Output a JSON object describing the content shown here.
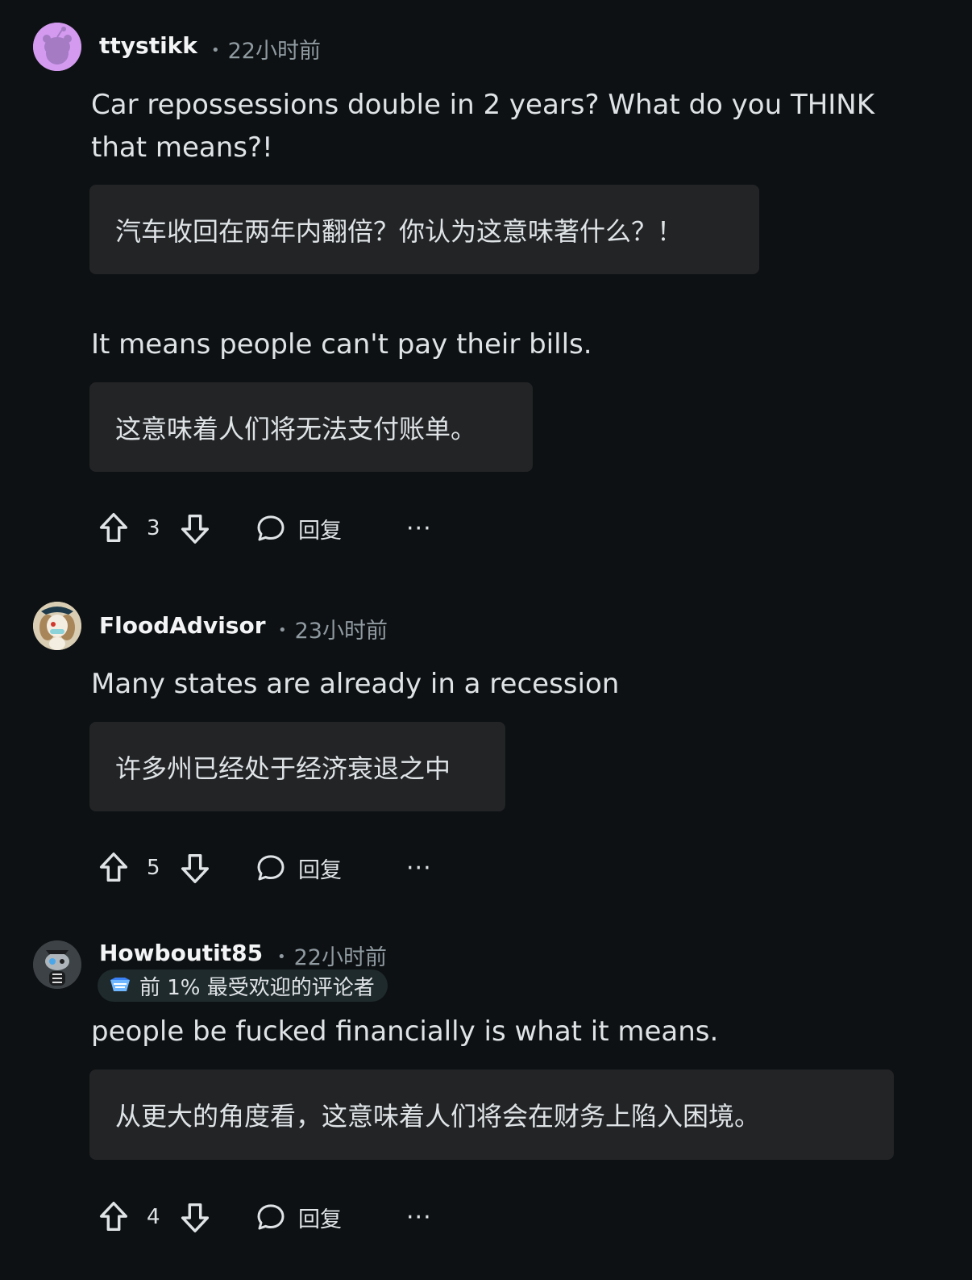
{
  "comments": [
    {
      "username": "ttystikk",
      "time": "22小时前",
      "paragraphs": [
        {
          "text": "Car repossessions double in 2 years? What do you THINK that means?!",
          "translation": "汽车收回在两年内翻倍？你认为这意味著什么？！"
        },
        {
          "text": "It means people can't pay their bills.",
          "translation": "这意味着人们将无法支付账单。"
        }
      ],
      "votes": "3",
      "reply_label": "回复",
      "more_label": "···"
    },
    {
      "username": "FloodAdvisor",
      "time": "23小时前",
      "paragraphs": [
        {
          "text": "Many states are already in a recession",
          "translation": "许多州已经处于经济衰退之中"
        }
      ],
      "votes": "5",
      "reply_label": "回复",
      "more_label": "···"
    },
    {
      "username": "Howboutit85",
      "time": "22小时前",
      "badge": "前 1% 最受欢迎的评论者",
      "paragraphs": [
        {
          "text": "people be fucked financially is what it means.",
          "translation": "从更大的角度看，这意味着人们将会在财务上陷入困境。"
        }
      ],
      "votes": "4",
      "reply_label": "回复",
      "more_label": "···"
    }
  ],
  "colors": {
    "background": "#0e1113",
    "translation_box": "#222426",
    "meta_text": "#8f9aa1",
    "avatar_1": "#d39af0"
  }
}
